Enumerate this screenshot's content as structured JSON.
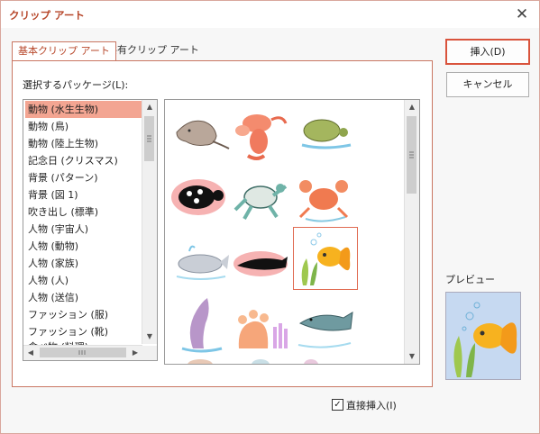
{
  "window": {
    "title": "クリップ アート",
    "close_glyph": "✕"
  },
  "tabs": [
    {
      "label": "基本クリップ アート",
      "active": true
    },
    {
      "label": "共有クリップ アート",
      "active": false
    }
  ],
  "package": {
    "label": "選択するパッケージ(L):",
    "items": [
      "動物 (水生生物)",
      "動物 (鳥)",
      "動物 (陸上生物)",
      "記念日 (クリスマス)",
      "背景 (パターン)",
      "背景 (図 1)",
      "吹き出し (標準)",
      "人物 (宇宙人)",
      "人物 (動物)",
      "人物 (家族)",
      "人物 (人)",
      "人物 (送信)",
      "ファッション (服)",
      "ファッション (靴)",
      "食べ物 (料理)"
    ],
    "selected_index": 0
  },
  "gallery": {
    "clips": [
      "stingray-clip",
      "lobster-clip",
      "turtle-clip",
      "black-turtle-clip",
      "sea-turtle-clip",
      "crab-clip",
      "whale-clip",
      "dolphin-silhouette-clip",
      "goldfish-clip",
      "jumping-dolphin-clip",
      "sea-anemone-clip",
      "catfish-clip"
    ],
    "selected_clip": "goldfish-clip"
  },
  "buttons": {
    "insert": "挿入(D)",
    "cancel": "キャンセル"
  },
  "preview": {
    "label": "プレビュー"
  },
  "direct_insert": {
    "label": "直接挿入(I)",
    "checked": true,
    "check_glyph": "✓"
  },
  "colors": {
    "accent": "#b7472a",
    "selection": "#f3a592",
    "default_border": "#d9533c",
    "preview_bg": "#c6d9f1"
  }
}
